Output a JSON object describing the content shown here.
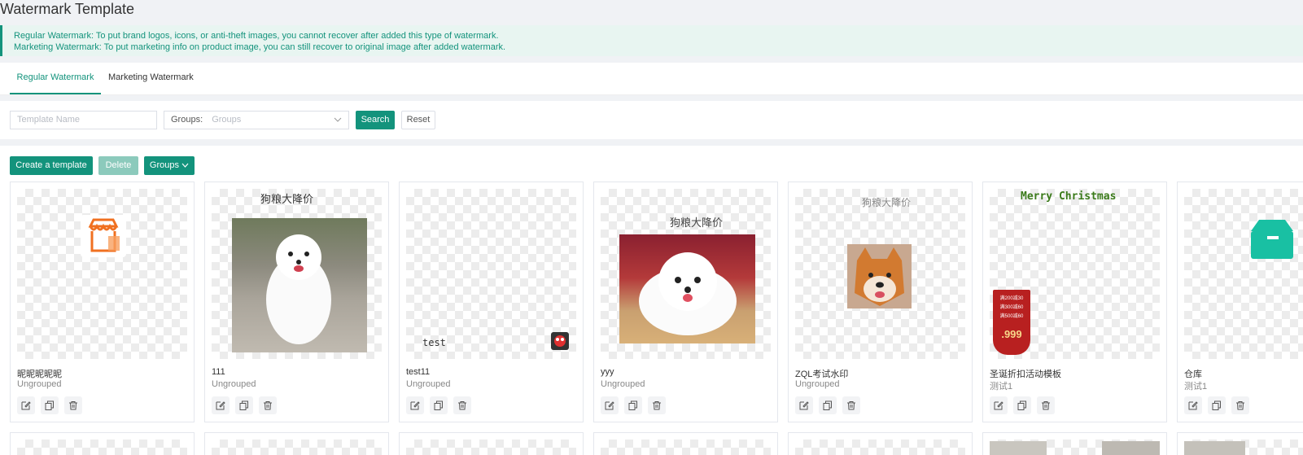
{
  "page": {
    "title": "Watermark Template"
  },
  "notice": {
    "line1": "Regular Watermark: To put brand logos, icons, or anti-theft images, you cannot recover after added this type of watermark.",
    "line2": "Marketing Watermark: To put marketing info on product image, you can still recover to original image after added watermark."
  },
  "tabs": [
    {
      "label": "Regular Watermark",
      "active": true
    },
    {
      "label": "Marketing Watermark",
      "active": false
    }
  ],
  "filters": {
    "name_placeholder": "Template Name",
    "groups_label": "Groups:",
    "groups_placeholder": "Groups",
    "search_label": "Search",
    "reset_label": "Reset"
  },
  "toolbar": {
    "create_label": "Create a template",
    "delete_label": "Delete",
    "groups_label": "Groups"
  },
  "cards": [
    {
      "name": "昵昵昵昵昵",
      "group": "Ungrouped",
      "preview": "shop-icon"
    },
    {
      "name": "111",
      "group": "Ungrouped",
      "preview": "samoyed-photo",
      "overlay_text": "狗粮大降价"
    },
    {
      "name": "test11",
      "group": "Ungrouped",
      "preview": "text-and-avatar",
      "overlay_text": "test"
    },
    {
      "name": "yyy",
      "group": "Ungrouped",
      "preview": "pomeranian-photo",
      "overlay_text": "狗粮大降价"
    },
    {
      "name": "ZQL考试水印",
      "group": "Ungrouped",
      "preview": "shiba-photo",
      "overlay_text": "狗粮大降价"
    },
    {
      "name": "圣诞折扣活动模板",
      "group": "测试1",
      "preview": "christmas-banner",
      "overlay_text": "Merry Christmas",
      "badge_lines": [
        "满200减30",
        "满300减60",
        "满500减60"
      ],
      "badge_price": "999"
    },
    {
      "name": "仓库",
      "group": "测试1",
      "preview": "box-icon"
    }
  ],
  "colors": {
    "accent": "#13937c",
    "notice_bg": "#e8f5f1",
    "disabled": "#8ccabc"
  }
}
